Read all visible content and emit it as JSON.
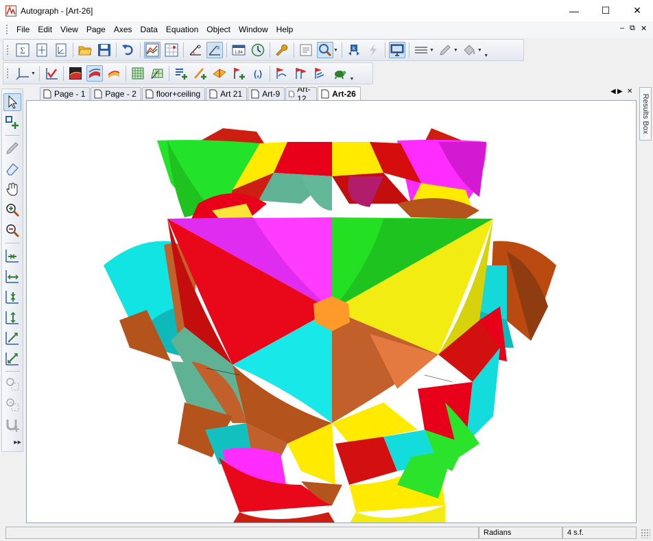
{
  "window": {
    "title": "Autograph - [Art-26]"
  },
  "menu": {
    "items": [
      "File",
      "Edit",
      "View",
      "Page",
      "Axes",
      "Data",
      "Equation",
      "Object",
      "Window",
      "Help"
    ]
  },
  "tabs": [
    {
      "label": "Page - 1",
      "active": false
    },
    {
      "label": "Page - 2",
      "active": false
    },
    {
      "label": "floor+ceiling",
      "active": false
    },
    {
      "label": "Art 21",
      "active": false
    },
    {
      "label": "Art-9",
      "active": false
    },
    {
      "label": "Art-12",
      "active": false
    },
    {
      "label": "Art-26",
      "active": true
    }
  ],
  "results_box": {
    "label": "Results Box"
  },
  "status": {
    "angle_mode": "Radians",
    "precision": "4 s.f."
  },
  "colors": {
    "accent": "#cfe3f7",
    "title_bg": "#ffffff",
    "chrome": "#f0f0f0"
  }
}
